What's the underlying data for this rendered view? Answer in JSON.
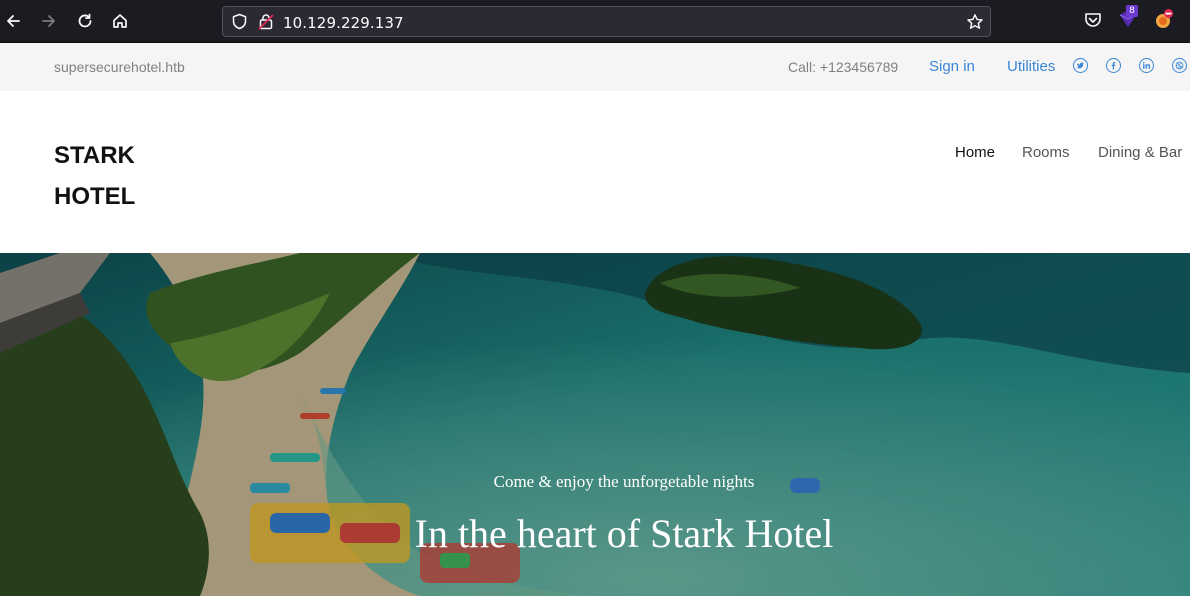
{
  "browser": {
    "url": "10.129.229.137",
    "extension_badge": "8",
    "icons": [
      "back-icon",
      "forward-icon",
      "reload-icon",
      "home-icon",
      "shield-icon",
      "lock-icon",
      "bookmark-star-icon",
      "pocket-icon",
      "extension-icon",
      "firefox-profile-icon"
    ]
  },
  "topbar": {
    "domain": "supersecurehotel.htb",
    "call": "Call: +123456789",
    "signin": "Sign in",
    "utilities": "Utilities",
    "social_icons": [
      "twitter-icon",
      "facebook-icon",
      "linkedin-icon",
      "dribbble-icon"
    ]
  },
  "header": {
    "brand_line1": "STARK",
    "brand_line2": "HOTEL",
    "menu": [
      {
        "label": "Home",
        "active": true
      },
      {
        "label": "Rooms",
        "active": false
      },
      {
        "label": "Dining & Bar",
        "active": false
      }
    ]
  },
  "hero": {
    "subtitle": "Come & enjoy the unforgetable nights",
    "title": "In the heart of Stark Hotel"
  },
  "colors": {
    "link": "#3a86d8",
    "chrome_bg": "#1c1b22",
    "topbar_bg": "#f5f5f5",
    "water": "#1b6f6c"
  }
}
